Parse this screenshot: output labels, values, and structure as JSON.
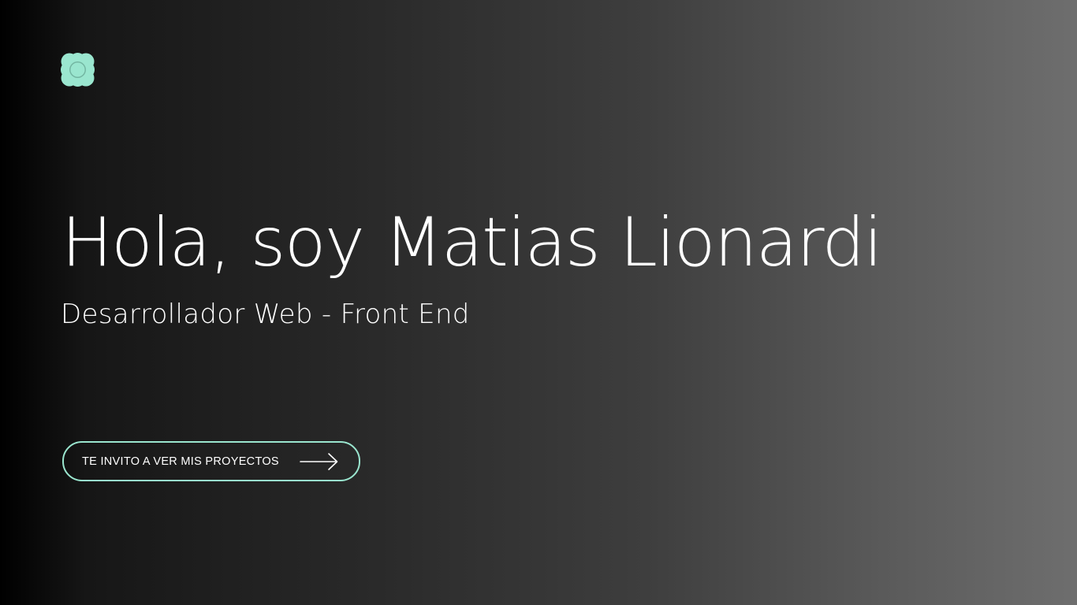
{
  "logo": {
    "icon": "flower-logo-icon",
    "color": "#9ae6cf"
  },
  "hero": {
    "title": "Hola, soy Matias Lionardi",
    "subtitle": "Desarrollador Web - Front End"
  },
  "cta": {
    "label": "TE INVITO A VER MIS PROYECTOS",
    "icon": "arrow-right-icon",
    "border_color": "#9ae6cf"
  }
}
